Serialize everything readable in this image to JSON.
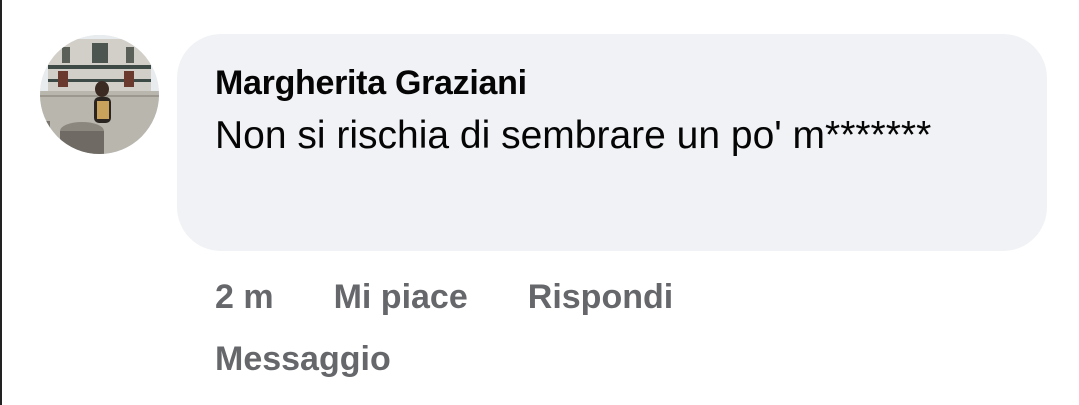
{
  "comment": {
    "author": "Margherita Graziani",
    "text": "Non si rischia di sembrare un po' m*******",
    "avatar_icon": "profile-photo"
  },
  "actions": {
    "time": "2 m",
    "like_label": "Mi piace",
    "reply_label": "Rispondi",
    "message_label": "Messaggio"
  },
  "colors": {
    "bubble_bg": "#f0f2f5",
    "text": "#050505",
    "meta": "#65676b"
  }
}
